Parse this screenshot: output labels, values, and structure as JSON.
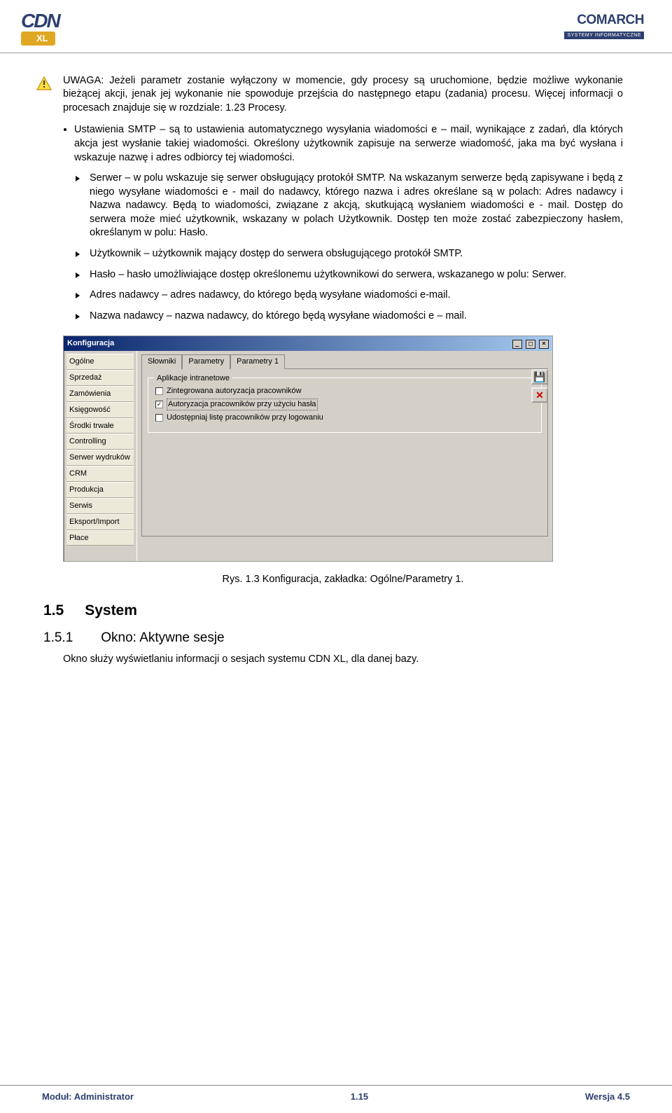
{
  "logos": {
    "cdn_text": "CDN",
    "xl_text": "XL",
    "comarch": "COMARCH",
    "comarch_sub": "SYSTEMY INFORMATYCZNE"
  },
  "warning": {
    "p1": "UWAGA: Jeżeli parametr zostanie wyłączony w momencie, gdy procesy są uruchomione, będzie możliwe wykonanie bieżącej akcji, jenak jej wykonanie nie spowoduje przejścia do następnego etapu (zadania) procesu. Więcej informacji o procesach znajduje się w rozdziale: 1.23 Procesy."
  },
  "main_bullet": "Ustawienia SMTP – są to ustawienia automatycznego wysyłania wiadomości e – mail, wynikające z zadań, dla których akcja jest wysłanie takiej wiadomości. Określony użytkownik zapisuje na serwerze wiadomość, jaka ma być wysłana i wskazuje nazwę i adres odbiorcy tej wiadomości.",
  "sub_bullets": [
    "Serwer – w polu wskazuje się serwer obsługujący protokół SMTP. Na wskazanym serwerze będą zapisywane i będą z niego wysyłane wiadomości e - mail do nadawcy, którego nazwa i adres określane są w polach: Adres nadawcy i Nazwa nadawcy. Będą to wiadomości, związane z akcją, skutkującą wysłaniem wiadomości e - mail. Dostęp do serwera może mieć użytkownik, wskazany w polach Użytkownik. Dostęp ten może zostać zabezpieczony hasłem, określanym w polu: Hasło.",
    "Użytkownik – użytkownik mający dostęp do serwera obsługującego protokół SMTP.",
    "Hasło – hasło umożliwiające dostęp określonemu użytkownikowi do serwera, wskazanego w polu: Serwer.",
    "Adres nadawcy – adres nadawcy, do którego będą wysyłane wiadomości e-mail.",
    "Nazwa nadawcy – nazwa nadawcy, do którego będą wysyłane wiadomości e – mail."
  ],
  "screenshot": {
    "title": "Konfiguracja",
    "sidebar": [
      "Ogólne",
      "Sprzedaż",
      "Zamówienia",
      "Księgowość",
      "Środki trwałe",
      "Controlling",
      "Serwer wydruków",
      "CRM",
      "Produkcja",
      "Serwis",
      "Eksport/Import",
      "Płace"
    ],
    "tabs": [
      "Słowniki",
      "Parametry",
      "Parametry 1"
    ],
    "group_label": "Aplikacje intranetowe",
    "checks": [
      {
        "label": "Zintegrowana autoryzacja pracowników",
        "checked": false
      },
      {
        "label": "Autoryzacja pracowników przy użyciu hasła",
        "checked": true
      },
      {
        "label": "Udostępniaj listę pracowników przy logowaniu",
        "checked": false
      }
    ]
  },
  "caption": "Rys. 1.3 Konfiguracja, zakładka: Ogólne/Parametry 1.",
  "h2_num": "1.5",
  "h2_txt": "System",
  "h3_num": "1.5.1",
  "h3_txt": "Okno: Aktywne sesje",
  "body_p": "Okno służy wyświetlaniu informacji o sesjach systemu CDN XL, dla danej bazy.",
  "footer": {
    "left": "Moduł: Administrator",
    "center": "1.15",
    "right": "Wersja 4.5"
  }
}
